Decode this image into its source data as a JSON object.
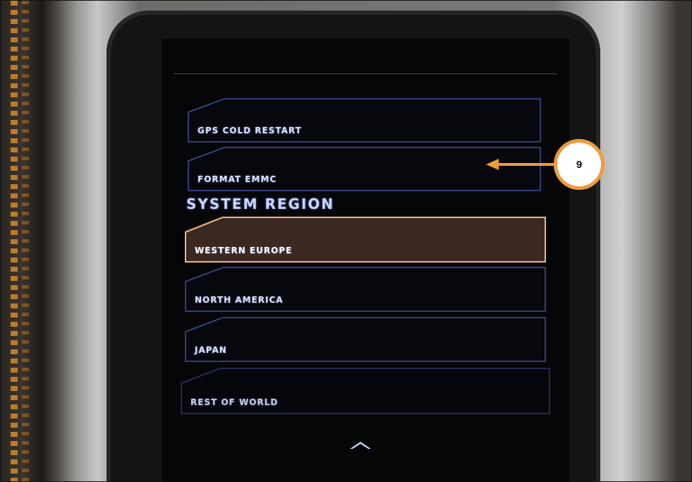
{
  "menu": {
    "items": [
      {
        "label": "GPS COLD RESTART",
        "selected": false
      },
      {
        "label": "FORMAT EMMC",
        "selected": false
      }
    ]
  },
  "system_region": {
    "title": "SYSTEM REGION",
    "options": [
      {
        "label": "WESTERN EUROPE",
        "selected": true
      },
      {
        "label": "NORTH AMERICA",
        "selected": false
      },
      {
        "label": "JAPAN",
        "selected": false
      },
      {
        "label": "REST OF WORLD",
        "selected": false
      }
    ]
  },
  "scroll_up_icon": "chevron-up-icon",
  "callout": {
    "number": "9",
    "color": "#ef9a3d"
  },
  "colors": {
    "button_outline": "#3e4f98",
    "selected_outline": "#f2b77a",
    "selected_fill": "#3b2820",
    "label": "#dbe4ff"
  }
}
